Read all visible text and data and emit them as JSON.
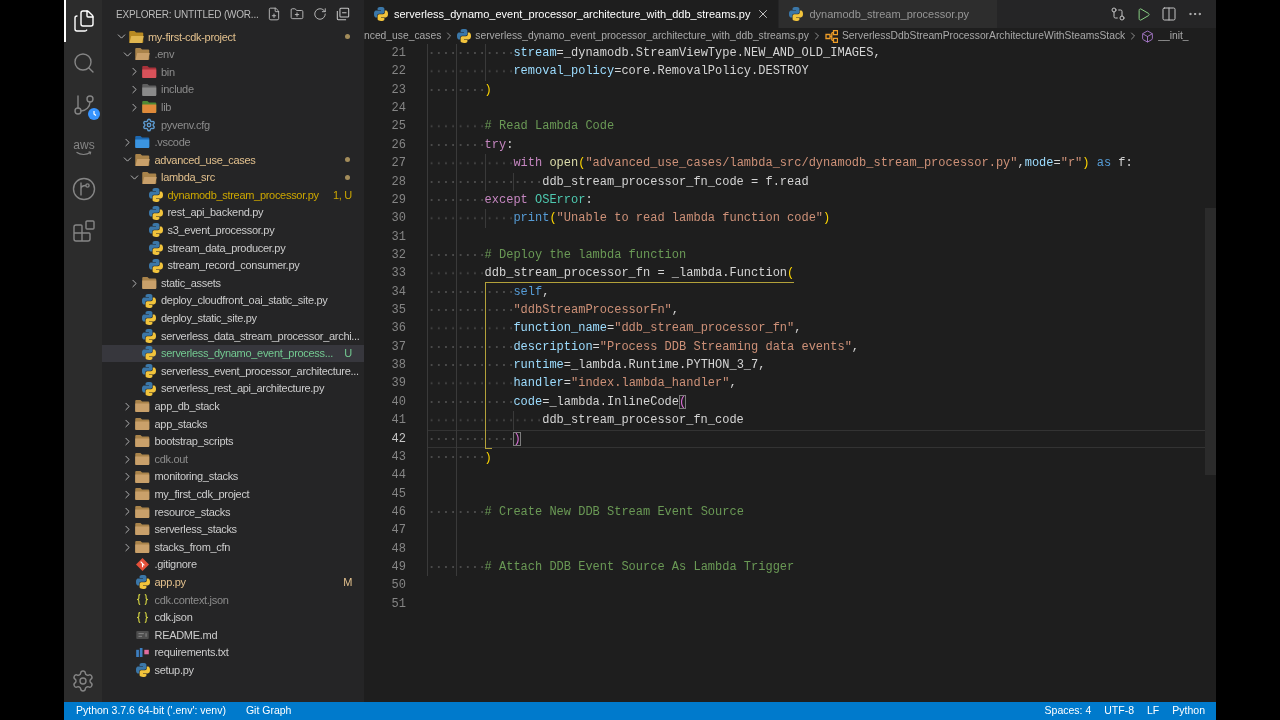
{
  "activity_bar": {
    "items": [
      {
        "kind": "explorer",
        "selected": true
      },
      {
        "kind": "search",
        "selected": false
      },
      {
        "kind": "source-control",
        "selected": false
      },
      {
        "kind": "aws",
        "label": "aws",
        "selected": false
      },
      {
        "kind": "git-graph",
        "selected": false
      },
      {
        "kind": "extensions",
        "selected": false
      }
    ]
  },
  "sidebar": {
    "title": "EXPLORER: UNTITLED (WOR...",
    "tree": [
      {
        "name": "my-first-cdk-project",
        "kind": "folder-root",
        "expanded": true,
        "modified": true,
        "color": "#e2c08d",
        "selected": false,
        "children": [
          {
            "name": ".env",
            "kind": "folder",
            "expanded": true,
            "modified": false,
            "color": "#8c8c8c",
            "selected": false,
            "children": [
              {
                "name": "bin",
                "kind": "folder-bin",
                "expanded": false,
                "modified": false,
                "color": "#8c8c8c",
                "selected": false
              },
              {
                "name": "include",
                "kind": "folder-include",
                "expanded": false,
                "modified": false,
                "color": "#8c8c8c",
                "selected": false
              },
              {
                "name": "lib",
                "kind": "folder-lib",
                "expanded": false,
                "modified": false,
                "color": "#8c8c8c",
                "selected": false
              },
              {
                "name": "pyvenv.cfg",
                "kind": "config",
                "color": "#8c8c8c",
                "selected": false
              }
            ]
          },
          {
            "name": ".vscode",
            "kind": "folder-vscode",
            "expanded": false,
            "modified": false,
            "color": "#8c8c8c",
            "selected": false
          },
          {
            "name": "advanced_use_cases",
            "kind": "folder",
            "expanded": true,
            "modified": true,
            "color": "#e2c08d",
            "selected": false,
            "children": [
              {
                "name": "lambda_src",
                "kind": "folder",
                "expanded": true,
                "modified": true,
                "color": "#e2c08d",
                "selected": false,
                "children": [
                  {
                    "name": "dynamodb_stream_processor.py",
                    "kind": "python",
                    "color": "#cca700",
                    "badge": "1, U",
                    "selected": false
                  },
                  {
                    "name": "rest_api_backend.py",
                    "kind": "python",
                    "color": "#cccccc",
                    "selected": false
                  },
                  {
                    "name": "s3_event_processor.py",
                    "kind": "python",
                    "color": "#cccccc",
                    "selected": false
                  },
                  {
                    "name": "stream_data_producer.py",
                    "kind": "python",
                    "color": "#cccccc",
                    "selected": false
                  },
                  {
                    "name": "stream_record_consumer.py",
                    "kind": "python",
                    "color": "#cccccc",
                    "selected": false
                  }
                ]
              },
              {
                "name": "static_assets",
                "kind": "folder",
                "expanded": false,
                "modified": false,
                "color": "#cccccc",
                "selected": false
              },
              {
                "name": "deploy_cloudfront_oai_static_site.py",
                "kind": "python",
                "color": "#cccccc",
                "selected": false
              },
              {
                "name": "deploy_static_site.py",
                "kind": "python",
                "color": "#cccccc",
                "selected": false
              },
              {
                "name": "serverless_data_stream_processor_archi...",
                "kind": "python",
                "color": "#cccccc",
                "selected": false
              },
              {
                "name": "serverless_dynamo_event_process...",
                "kind": "python",
                "color": "#73c991",
                "badge": "U",
                "selected": true
              },
              {
                "name": "serverless_event_processor_architecture...",
                "kind": "python",
                "color": "#cccccc",
                "selected": false
              },
              {
                "name": "serverless_rest_api_architecture.py",
                "kind": "python",
                "color": "#cccccc",
                "selected": false
              }
            ]
          },
          {
            "name": "app_db_stack",
            "kind": "folder",
            "expanded": false,
            "modified": false,
            "color": "#cccccc",
            "selected": false
          },
          {
            "name": "app_stacks",
            "kind": "folder",
            "expanded": false,
            "modified": false,
            "color": "#cccccc",
            "selected": false
          },
          {
            "name": "bootstrap_scripts",
            "kind": "folder",
            "expanded": false,
            "modified": false,
            "color": "#cccccc",
            "selected": false
          },
          {
            "name": "cdk.out",
            "kind": "folder",
            "expanded": false,
            "modified": false,
            "color": "#8c8c8c",
            "selected": false
          },
          {
            "name": "monitoring_stacks",
            "kind": "folder",
            "expanded": false,
            "modified": false,
            "color": "#cccccc",
            "selected": false
          },
          {
            "name": "my_first_cdk_project",
            "kind": "folder",
            "expanded": false,
            "modified": false,
            "color": "#cccccc",
            "selected": false
          },
          {
            "name": "resource_stacks",
            "kind": "folder",
            "expanded": false,
            "modified": false,
            "color": "#cccccc",
            "selected": false
          },
          {
            "name": "serverless_stacks",
            "kind": "folder",
            "expanded": false,
            "modified": false,
            "color": "#cccccc",
            "selected": false
          },
          {
            "name": "stacks_from_cfn",
            "kind": "folder",
            "expanded": false,
            "modified": false,
            "color": "#cccccc",
            "selected": false
          },
          {
            "name": ".gitignore",
            "kind": "git",
            "color": "#cccccc",
            "selected": false
          },
          {
            "name": "app.py",
            "kind": "python",
            "color": "#e2c08d",
            "badge": "M",
            "selected": false
          },
          {
            "name": "cdk.context.json",
            "kind": "json",
            "color": "#8c8c8c",
            "selected": false
          },
          {
            "name": "cdk.json",
            "kind": "json",
            "color": "#cccccc",
            "selected": false
          },
          {
            "name": "README.md",
            "kind": "markdown",
            "color": "#cccccc",
            "selected": false
          },
          {
            "name": "requirements.txt",
            "kind": "text",
            "color": "#cccccc",
            "selected": false
          },
          {
            "name": "setup.py",
            "kind": "python",
            "color": "#cccccc",
            "selected": false
          }
        ]
      }
    ]
  },
  "editor": {
    "tabs": [
      {
        "label": "serverless_dynamo_event_processor_architecture_with_ddb_streams.py",
        "kind": "python",
        "selected": true
      },
      {
        "label": "dynamodb_stream_processor.py",
        "kind": "python",
        "selected": false
      }
    ],
    "breadcrumb": [
      {
        "label": "nced_use_cases"
      },
      {
        "label": "serverless_dynamo_event_processor_architecture_with_ddb_streams.py",
        "kind": "python"
      },
      {
        "label": "ServerlessDdbStreamProcessorArchitectureWithSteamsStack",
        "kind": "class"
      },
      {
        "label": "__init_",
        "kind": "method"
      }
    ],
    "lines": [
      {
        "number": "21",
        "current": false,
        "tokens": [
          {
            "text": "            stream",
            "kind": "param"
          },
          {
            "text": "=_dynamodb.StreamViewType.NEW_AND_OLD_IMAGES,",
            "kind": "plain"
          }
        ]
      },
      {
        "number": "22",
        "current": false,
        "tokens": [
          {
            "text": "            removal_policy",
            "kind": "param"
          },
          {
            "text": "=core.RemovalPolicy.DESTROY",
            "kind": "plain"
          }
        ]
      },
      {
        "number": "23",
        "current": false,
        "tokens": [
          {
            "text": "        )",
            "kind": "bracket1"
          }
        ]
      },
      {
        "number": "24",
        "current": false
      },
      {
        "number": "25",
        "current": false,
        "tokens": [
          {
            "text": "        # Read Lambda Code",
            "kind": "comment"
          }
        ]
      },
      {
        "number": "26",
        "current": false,
        "tokens": [
          {
            "text": "        try",
            "kind": "control"
          },
          {
            "text": ":",
            "kind": "plain"
          }
        ]
      },
      {
        "number": "27",
        "current": false,
        "tokens": [
          {
            "text": "            with ",
            "kind": "control"
          },
          {
            "text": "open",
            "kind": "function"
          },
          {
            "text": "(",
            "kind": "bracket1"
          },
          {
            "text": "\"advanced_use_cases/lambda_src/dynamodb_stream_processor.py\"",
            "kind": "string"
          },
          {
            "text": ",",
            "kind": "plain"
          },
          {
            "text": "mode",
            "kind": "param"
          },
          {
            "text": "=",
            "kind": "plain"
          },
          {
            "text": "\"r\"",
            "kind": "string"
          },
          {
            "text": ")",
            "kind": "bracket1"
          },
          {
            "text": " as",
            "kind": "keyword"
          },
          {
            "text": " f:",
            "kind": "plain"
          }
        ]
      },
      {
        "number": "28",
        "current": false,
        "tokens": [
          {
            "text": "                ddb_stream_processor_fn_code = f.read",
            "kind": "plain"
          }
        ]
      },
      {
        "number": "29",
        "current": false,
        "tokens": [
          {
            "text": "        except ",
            "kind": "control"
          },
          {
            "text": "OSError",
            "kind": "class"
          },
          {
            "text": ":",
            "kind": "plain"
          }
        ]
      },
      {
        "number": "30",
        "current": false,
        "tokens": [
          {
            "text": "            print",
            "kind": "keyword"
          },
          {
            "text": "(",
            "kind": "bracket1"
          },
          {
            "text": "\"Unable to read lambda function code\"",
            "kind": "string"
          },
          {
            "text": ")",
            "kind": "bracket1"
          }
        ]
      },
      {
        "number": "31",
        "current": false
      },
      {
        "number": "32",
        "current": false,
        "tokens": [
          {
            "text": "        # Deploy the lambda function",
            "kind": "comment"
          }
        ]
      },
      {
        "number": "33",
        "current": false,
        "bracket_guide": true,
        "tokens": [
          {
            "text": "        ddb_stream_processor_fn = _lambda.Function",
            "kind": "plain"
          },
          {
            "text": "(",
            "kind": "bracket1"
          }
        ]
      },
      {
        "number": "34",
        "current": false,
        "bracket_guide": true,
        "tokens": [
          {
            "text": "            self",
            "kind": "keyword"
          },
          {
            "text": ",",
            "kind": "plain"
          }
        ]
      },
      {
        "number": "35",
        "current": false,
        "bracket_guide": true,
        "tokens": [
          {
            "text": "            \"ddbStreamProcessorFn\"",
            "kind": "string"
          },
          {
            "text": ",",
            "kind": "plain"
          }
        ]
      },
      {
        "number": "36",
        "current": false,
        "bracket_guide": true,
        "tokens": [
          {
            "text": "            function_name",
            "kind": "param"
          },
          {
            "text": "=",
            "kind": "plain"
          },
          {
            "text": "\"ddb_stream_processor_fn\"",
            "kind": "string"
          },
          {
            "text": ",",
            "kind": "plain"
          }
        ]
      },
      {
        "number": "37",
        "current": false,
        "bracket_guide": true,
        "tokens": [
          {
            "text": "            description",
            "kind": "param"
          },
          {
            "text": "=",
            "kind": "plain"
          },
          {
            "text": "\"Process DDB Streaming data events\"",
            "kind": "string"
          },
          {
            "text": ",",
            "kind": "plain"
          }
        ]
      },
      {
        "number": "38",
        "current": false,
        "bracket_guide": true,
        "tokens": [
          {
            "text": "            runtime",
            "kind": "param"
          },
          {
            "text": "=_lambda.Runtime.PYTHON_3_7,",
            "kind": "plain"
          }
        ]
      },
      {
        "number": "39",
        "current": false,
        "bracket_guide": true,
        "tokens": [
          {
            "text": "            handler",
            "kind": "param"
          },
          {
            "text": "=",
            "kind": "plain"
          },
          {
            "text": "\"index.lambda_handler\"",
            "kind": "string"
          },
          {
            "text": ",",
            "kind": "plain"
          }
        ]
      },
      {
        "number": "40",
        "current": false,
        "bracket_guide": true,
        "tokens": [
          {
            "text": "            code",
            "kind": "param"
          },
          {
            "text": "=_lambda.InlineCode",
            "kind": "plain"
          },
          {
            "text": "(",
            "kind": "bracket-match"
          }
        ]
      },
      {
        "number": "41",
        "current": false,
        "bracket_guide": true,
        "tokens": [
          {
            "text": "                ddb_stream_processor_fn_code",
            "kind": "plain"
          }
        ]
      },
      {
        "number": "42",
        "current": true,
        "bracket_guide": true,
        "tokens": [
          {
            "text": "            )",
            "kind": "bracket-match"
          }
        ]
      },
      {
        "number": "43",
        "current": false,
        "bracket_guide": true,
        "tokens": [
          {
            "text": "        )",
            "kind": "bracket1"
          }
        ]
      },
      {
        "number": "44",
        "current": false
      },
      {
        "number": "45",
        "current": false
      },
      {
        "number": "46",
        "current": false,
        "tokens": [
          {
            "text": "        # Create New DDB Stream Event Source",
            "kind": "comment"
          }
        ]
      },
      {
        "number": "47",
        "current": false
      },
      {
        "number": "48",
        "current": false
      },
      {
        "number": "49",
        "current": false,
        "tokens": [
          {
            "text": "        # Attach DDB Event Source As Lambda Trigger",
            "kind": "comment"
          }
        ]
      },
      {
        "number": "50",
        "current": false
      },
      {
        "number": "51",
        "current": false
      }
    ]
  },
  "status_bar": {
    "left": [
      "Python 3.7.6 64-bit ('.env': venv)",
      "Git Graph"
    ],
    "right": [
      "Spaces: 4",
      "UTF-8",
      "LF",
      "Python"
    ]
  }
}
